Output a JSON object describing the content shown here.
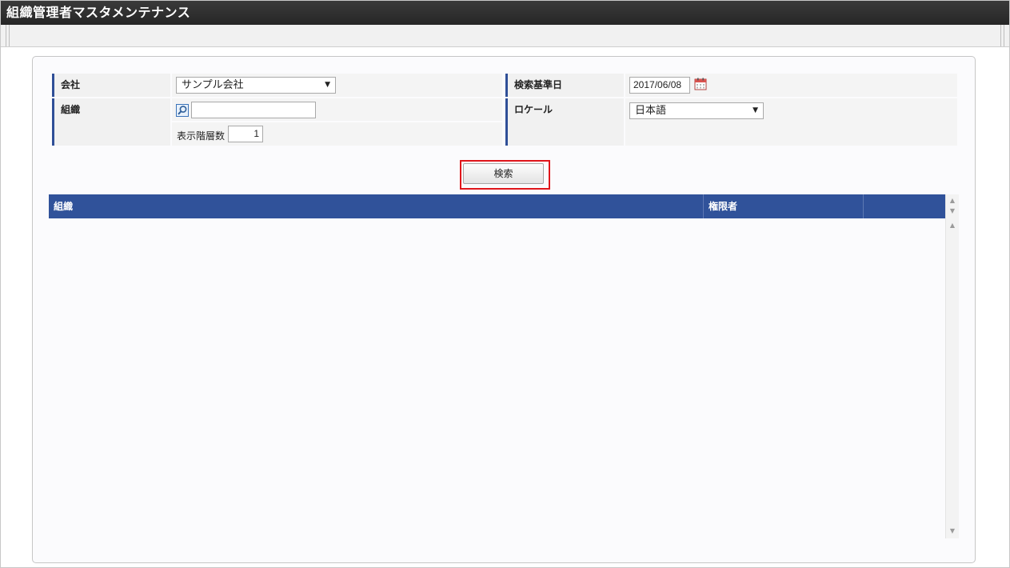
{
  "window": {
    "title": "組織管理者マスタメンテナンス"
  },
  "form": {
    "company": {
      "label": "会社",
      "selected": "サンプル会社"
    },
    "base_date": {
      "label": "検索基準日",
      "value": "2017/06/08"
    },
    "organization": {
      "label": "組織",
      "value": "",
      "depth_label": "表示階層数",
      "depth_value": "1"
    },
    "locale": {
      "label": "ロケール",
      "selected": "日本語"
    }
  },
  "search_button": {
    "label": "検索"
  },
  "grid": {
    "columns": [
      "組織",
      "権限者"
    ],
    "rows": []
  },
  "icons": {
    "calendar": "calendar-icon",
    "lookup": "search-icon",
    "dropdown": "chevron-down-icon",
    "scroll_up": "scroll-up-icon",
    "scroll_down": "scroll-down-icon"
  },
  "colors": {
    "header_bg": "#30529a",
    "title_bg": "#2b2b2b",
    "highlight": "#e0161b",
    "label_accent": "#2f4f97"
  }
}
